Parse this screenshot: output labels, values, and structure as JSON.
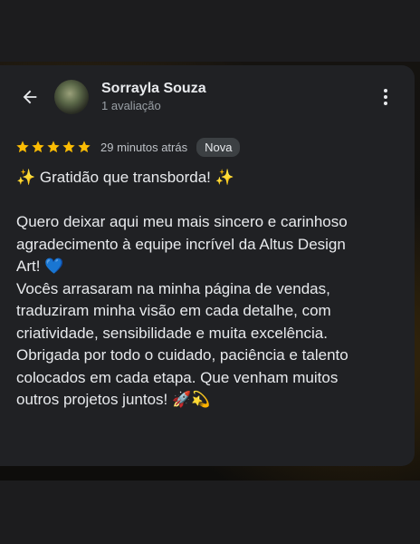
{
  "header": {
    "author_name": "Sorrayla Souza",
    "author_meta": "1 avaliação"
  },
  "rating": {
    "stars": 5,
    "time": "29 minutos atrás",
    "badge": "Nova"
  },
  "review": {
    "title": "✨ Gratidão que transborda! ✨",
    "lines": [
      "Quero deixar aqui meu mais sincero e carinhoso",
      "agradecimento à equipe incrível da Altus Design",
      "Art! 💙",
      "Vocês arrasaram na minha página de vendas,",
      "traduziram minha visão em cada detalhe, com",
      "criatividade, sensibilidade e muita excelência.",
      "Obrigada por todo o cuidado, paciência e talento",
      "colocados em cada etapa. Que venham muitos",
      "outros projetos juntos! 🚀💫"
    ]
  },
  "colors": {
    "card_bg": "#202124",
    "star": "#fbbc04",
    "heart": "#1a73e8"
  }
}
